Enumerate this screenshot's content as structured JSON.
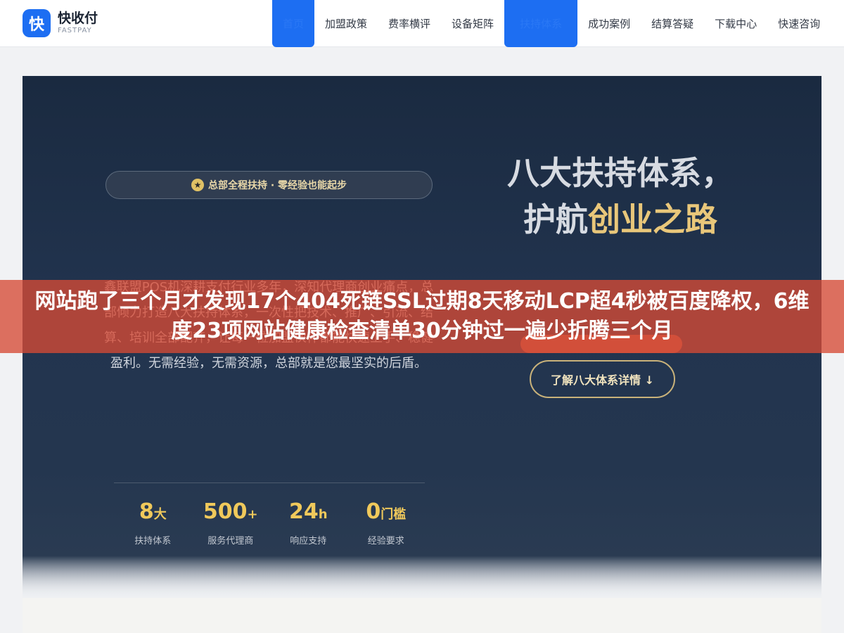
{
  "header": {
    "logo_mark": "快",
    "logo_name": "快收付",
    "logo_sub": "FASTPAY",
    "nav": [
      {
        "label": "首页",
        "active": true
      },
      {
        "label": "加盟政策",
        "active": false
      },
      {
        "label": "费率横评",
        "active": false
      },
      {
        "label": "设备矩阵",
        "active": false
      },
      {
        "label": "扶持体系",
        "active": true
      },
      {
        "label": "成功案例",
        "active": false
      },
      {
        "label": "结算答疑",
        "active": false
      },
      {
        "label": "下载中心",
        "active": false
      },
      {
        "label": "快速咨询",
        "active": false
      }
    ]
  },
  "hero": {
    "badge_text": "总部全程扶持 · 零经验也能起步",
    "headline_line1": "八大扶持体系，",
    "headline_line2_plain": "护航",
    "headline_line2_accent": "创业之路",
    "description": "鑫联盟POS机深耕支付行业多年，深知代理商创业痛点，总部倾力打造八大扶持体系，一次性把技术、推广、引流、结算、培训全部配齐，让每一位加盟伙伴都能快速上手、稳健盈利。无需经验，无需资源，总部就是您最坚实的后盾。",
    "cta_primary": "立即申请加盟",
    "cta_secondary": "了解八大体系详情 ↓",
    "stats": [
      {
        "value": "8",
        "unit": "大",
        "label": "扶持体系"
      },
      {
        "value": "500",
        "unit": "+",
        "label": "服务代理商"
      },
      {
        "value": "24",
        "unit": "h",
        "label": "响应支持"
      },
      {
        "value": "0",
        "unit": "门槛",
        "label": "经验要求"
      }
    ]
  },
  "overlay": {
    "title": "网站跑了三个月才发现17个404死链SSL过期8天移动LCP超4秒被百度降权，6维度23项网站健康检查清单30分钟过一遍少折腾三个月"
  },
  "colors": {
    "brand_blue": "#1d6ef2",
    "gold": "#e9c77a",
    "overlay_red": "#d64a34"
  }
}
